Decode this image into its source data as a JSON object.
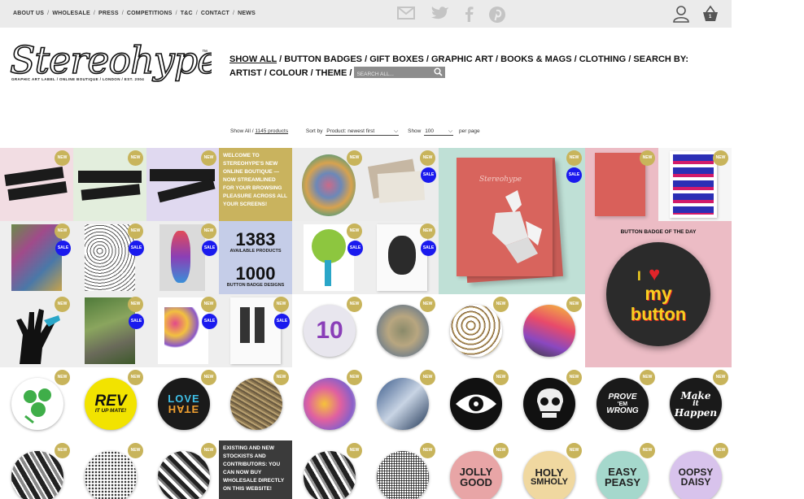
{
  "top_links": [
    "ABOUT US",
    "WHOLESALE",
    "PRESS",
    "COMPETITIONS",
    "T&C",
    "CONTACT",
    "NEWS"
  ],
  "social_icons": [
    "mail-icon",
    "twitter-icon",
    "facebook-icon",
    "pinterest-icon"
  ],
  "header_icons": [
    "account-icon",
    "basket-icon"
  ],
  "basket_count": "1",
  "logo": {
    "text": "Stereohype",
    "tm": "™",
    "subtitle": "GRAPHIC ART LABEL / ONLINE BOUTIQUE / LONDON / EST. 2004"
  },
  "nav": {
    "items": [
      "SHOW ALL",
      "BUTTON BADGES",
      "GIFT BOXES",
      "GRAPHIC ART",
      "BOOKS & MAGS",
      "CLOTHING",
      "SEARCH BY: ARTIST",
      "COLOUR",
      "THEME"
    ],
    "separator": "/",
    "search_placeholder": "SEARCH ALL..."
  },
  "filters": {
    "show_all_label": "Show All /",
    "product_count": "1145 products",
    "sort_label": "Sort by",
    "sort_value": "Product: newest first",
    "show_label": "Show",
    "show_value": "100",
    "per_page": "per page"
  },
  "badges": {
    "new": "NEW",
    "sale": "SALE"
  },
  "promo": {
    "welcome": "WELCOME TO STEREOHYPE'S NEW ONLINE BOUTIQUE — NOW STREAMLINED FOR YOUR BROWSING PLEASURE ACROSS ALL YOUR SCREENS!",
    "stat_number_1": "1383",
    "stat_label_1": "AVAILABLE PRODUCTS",
    "stat_number_2": "1000",
    "stat_label_2": "BUTTON BADGE DESIGNS",
    "badge_of_day_title": "BUTTON BADGE OF THE DAY",
    "badge_of_day_text": [
      "I",
      "my",
      "button"
    ],
    "wholesale": "EXISTING AND NEW STOCKISTS AND CONTRIBUTORS: YOU CAN NOW BUY WHOLESALE DIRECTLY ON THIS WEBSITE!"
  },
  "button_texts": {
    "rev": [
      "REV",
      "IT UP MATE!"
    ],
    "love": [
      "LOVE",
      "HATE"
    ],
    "ten": "10",
    "prove": [
      "PROVE",
      "'EM",
      "WRONG"
    ],
    "make": [
      "Make",
      "it",
      "Happen"
    ],
    "jolly": [
      "JOLLY",
      "GOOD"
    ],
    "holy": [
      "HOLY",
      "SMHOLY"
    ],
    "easy": [
      "EASY",
      "PEASY"
    ],
    "oopsy": [
      "OOPSY",
      "DAISY"
    ],
    "book_title": "Stereohype"
  },
  "colors": {
    "badge_new": "#c8b45b",
    "badge_sale": "#1a1aee",
    "welcome_bg": "#c9b35e",
    "stats_bg": "#c5cde8",
    "wholesale_bg": "#3b3b3b",
    "featured_bg": "#bfe0d6",
    "badge_day_bg": "#ecbcc5"
  }
}
